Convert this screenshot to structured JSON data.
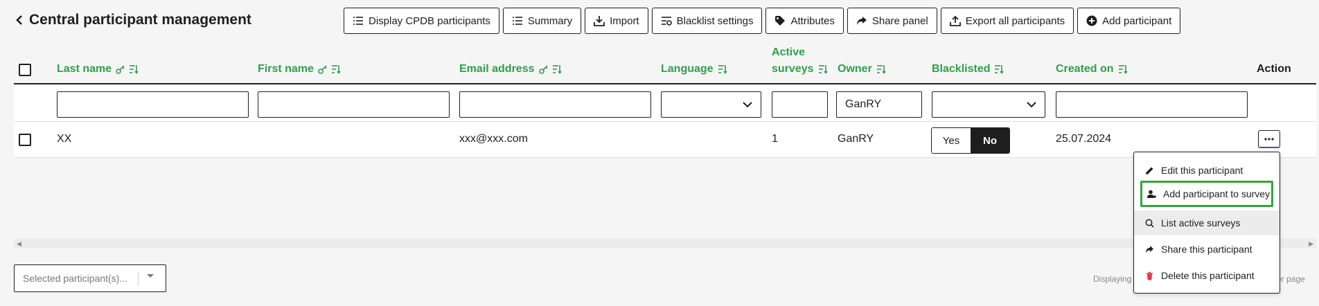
{
  "header": {
    "title": "Central participant management"
  },
  "toolbar": {
    "display_cpdb": "Display CPDB participants",
    "summary": "Summary",
    "import": "Import",
    "blacklist_settings": "Blacklist settings",
    "attributes": "Attributes",
    "share_panel": "Share panel",
    "export_all": "Export all participants",
    "add_participant": "Add participant"
  },
  "table": {
    "columns": {
      "last_name": "Last name",
      "first_name": "First name",
      "email": "Email address",
      "language": "Language",
      "active_surveys_1": "Active",
      "active_surveys_2": "surveys",
      "owner": "Owner",
      "blacklisted": "Blacklisted",
      "created_on": "Created on",
      "action": "Action"
    },
    "filters": {
      "last_name": "",
      "first_name": "",
      "email": "",
      "language": "",
      "active_surveys": "",
      "owner": "GanRY",
      "blacklisted": "",
      "created_on": ""
    },
    "row": {
      "last_name": "XX",
      "first_name": "",
      "email": "xxx@xxx.com",
      "language": "",
      "active_surveys": "1",
      "owner": "GanRY",
      "blacklisted_yes": "Yes",
      "blacklisted_no": "No",
      "blacklisted_selected": "No",
      "created_on": "25.07.2024"
    }
  },
  "action_menu": {
    "items": [
      {
        "label": "Edit this participant",
        "icon": "pencil-icon"
      },
      {
        "label": "Add participant to survey",
        "icon": "add-user-icon"
      },
      {
        "label": "List active surveys",
        "icon": "search-icon"
      },
      {
        "label": "Share this participant",
        "icon": "share-arrow-icon"
      },
      {
        "label": "Delete this participant",
        "icon": "trash-icon"
      }
    ]
  },
  "footer": {
    "bulk_placeholder": "Selected participant(s)...",
    "pager_text_left": "Displaying",
    "pager_text_right": "er page"
  },
  "colors": {
    "accent": "#2e9f4a",
    "highlight": "#2ea836",
    "danger": "#e0384b"
  }
}
